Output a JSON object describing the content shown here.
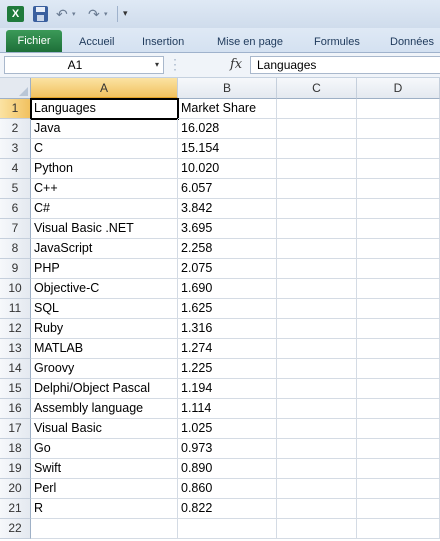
{
  "app": {
    "icon_letter": "X"
  },
  "quick_access": {
    "icons": [
      "excel-icon",
      "save-icon",
      "undo-icon",
      "redo-icon",
      "customize-icon"
    ],
    "undo_glyph": "↶",
    "redo_glyph": "↷",
    "dropdown_glyph": "▾",
    "customize_glyph": "▾"
  },
  "ribbon": {
    "tabs": [
      "Fichier",
      "Accueil",
      "Insertion",
      "Mise en page",
      "Formules",
      "Données"
    ],
    "file_color": "#217346"
  },
  "formula_bar": {
    "name_box": "A1",
    "fx_label": "fx",
    "content": "Languages"
  },
  "sheet": {
    "columns": [
      "A",
      "B",
      "C",
      "D"
    ],
    "active_cell": "A1",
    "rows": [
      {
        "n": "1",
        "a": "Languages",
        "b": "Market Share"
      },
      {
        "n": "2",
        "a": "Java",
        "b": "16.028"
      },
      {
        "n": "3",
        "a": "C",
        "b": "15.154"
      },
      {
        "n": "4",
        "a": "Python",
        "b": "10.020"
      },
      {
        "n": "5",
        "a": "C++",
        "b": "6.057"
      },
      {
        "n": "6",
        "a": "C#",
        "b": "3.842"
      },
      {
        "n": "7",
        "a": "Visual Basic .NET",
        "b": "3.695"
      },
      {
        "n": "8",
        "a": "JavaScript",
        "b": "2.258"
      },
      {
        "n": "9",
        "a": "PHP",
        "b": "2.075"
      },
      {
        "n": "10",
        "a": "Objective-C",
        "b": "1.690"
      },
      {
        "n": "11",
        "a": "SQL",
        "b": "1.625"
      },
      {
        "n": "12",
        "a": "Ruby",
        "b": "1.316"
      },
      {
        "n": "13",
        "a": "MATLAB",
        "b": "1.274"
      },
      {
        "n": "14",
        "a": "Groovy",
        "b": "1.225"
      },
      {
        "n": "15",
        "a": "Delphi/Object Pascal",
        "b": "1.194"
      },
      {
        "n": "16",
        "a": "Assembly language",
        "b": "1.114"
      },
      {
        "n": "17",
        "a": "Visual Basic",
        "b": "1.025"
      },
      {
        "n": "18",
        "a": "Go",
        "b": "0.973"
      },
      {
        "n": "19",
        "a": "Swift",
        "b": "0.890"
      },
      {
        "n": "20",
        "a": "Perl",
        "b": "0.860"
      },
      {
        "n": "21",
        "a": "R",
        "b": "0.822"
      },
      {
        "n": "22",
        "a": "",
        "b": ""
      }
    ]
  }
}
